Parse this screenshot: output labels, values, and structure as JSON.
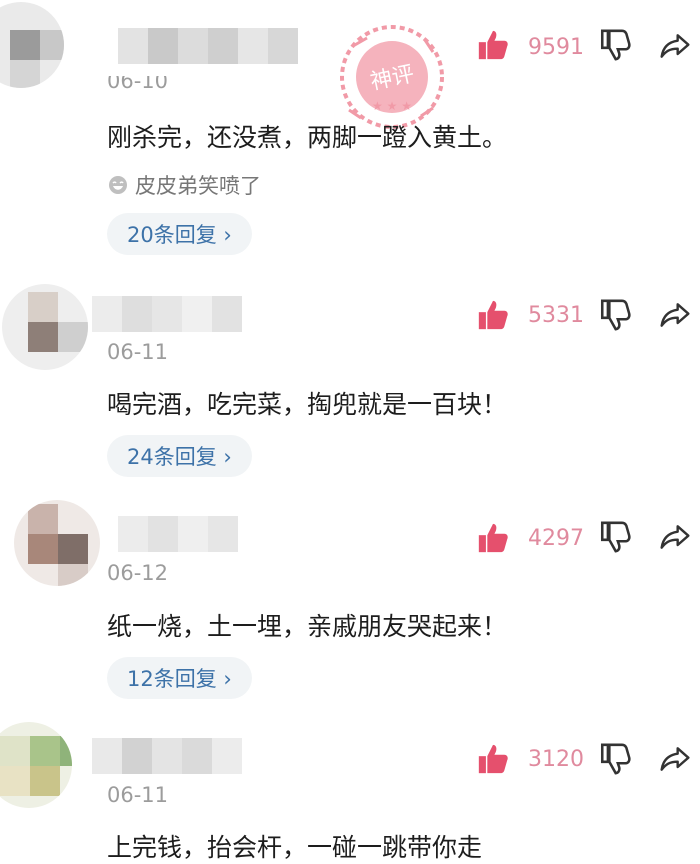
{
  "comments": [
    {
      "date": "06-10",
      "text": "刚杀完，还没煮，两脚一蹬入黄土。",
      "likes": "9591",
      "reaction": "皮皮弟笑喷了",
      "replies": "20条回复 ›",
      "reaction_icon": "laugh-icon"
    },
    {
      "date": "06-11",
      "text": "喝完酒，吃完菜，掏兜就是一百块！",
      "likes": "5331",
      "replies": "24条回复 ›"
    },
    {
      "date": "06-12",
      "text": "纸一烧，土一埋，亲戚朋友哭起来！",
      "likes": "4297",
      "replies": "12条回复 ›"
    },
    {
      "date": "06-11",
      "text": "上完钱，抬会杆，一碰一跳带你走",
      "likes": "3120"
    }
  ],
  "icons": {
    "like": "thumbs-up-icon",
    "dislike": "thumbs-down-icon",
    "share": "share-icon"
  },
  "stamp_text": "神评",
  "colors": {
    "like_red": "#e5506d",
    "count_pink": "#e08a9e",
    "reply_blue": "#3d72a8",
    "pill_bg": "#f1f4f6",
    "stamp_red": "#f19aa7"
  }
}
